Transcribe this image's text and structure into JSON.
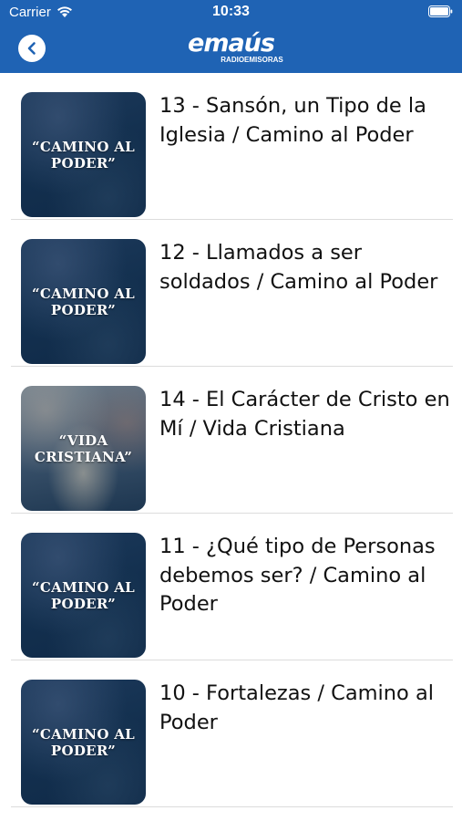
{
  "status_bar": {
    "carrier": "Carrier",
    "time": "10:33"
  },
  "header": {
    "logo_main": "emaús",
    "logo_sub": "RADIOEMISORAS",
    "back_icon": "chevron-left-icon",
    "background": "#1f63b4"
  },
  "episodes": [
    {
      "title": "13 - Sansón, un Tipo de la Iglesia / Camino al Poder",
      "thumb_line1": "“CAMINO AL",
      "thumb_line2": "PODER”",
      "thumb_style": "camino"
    },
    {
      "title": "12 - Llamados a ser soldados / Camino al Poder",
      "thumb_line1": "“CAMINO AL",
      "thumb_line2": "PODER”",
      "thumb_style": "camino"
    },
    {
      "title": "14 - El Carácter de Cristo en Mí / Vida Cristiana",
      "thumb_line1": "“VIDA",
      "thumb_line2": "CRISTIANA”",
      "thumb_style": "vida"
    },
    {
      "title": "11 - ¿Qué tipo de Personas debemos ser? / Camino al Poder",
      "thumb_line1": "“CAMINO AL",
      "thumb_line2": "PODER”",
      "thumb_style": "camino"
    },
    {
      "title": "10 - Fortalezas / Camino al Poder",
      "thumb_line1": "“CAMINO AL",
      "thumb_line2": "PODER”",
      "thumb_style": "camino"
    }
  ]
}
